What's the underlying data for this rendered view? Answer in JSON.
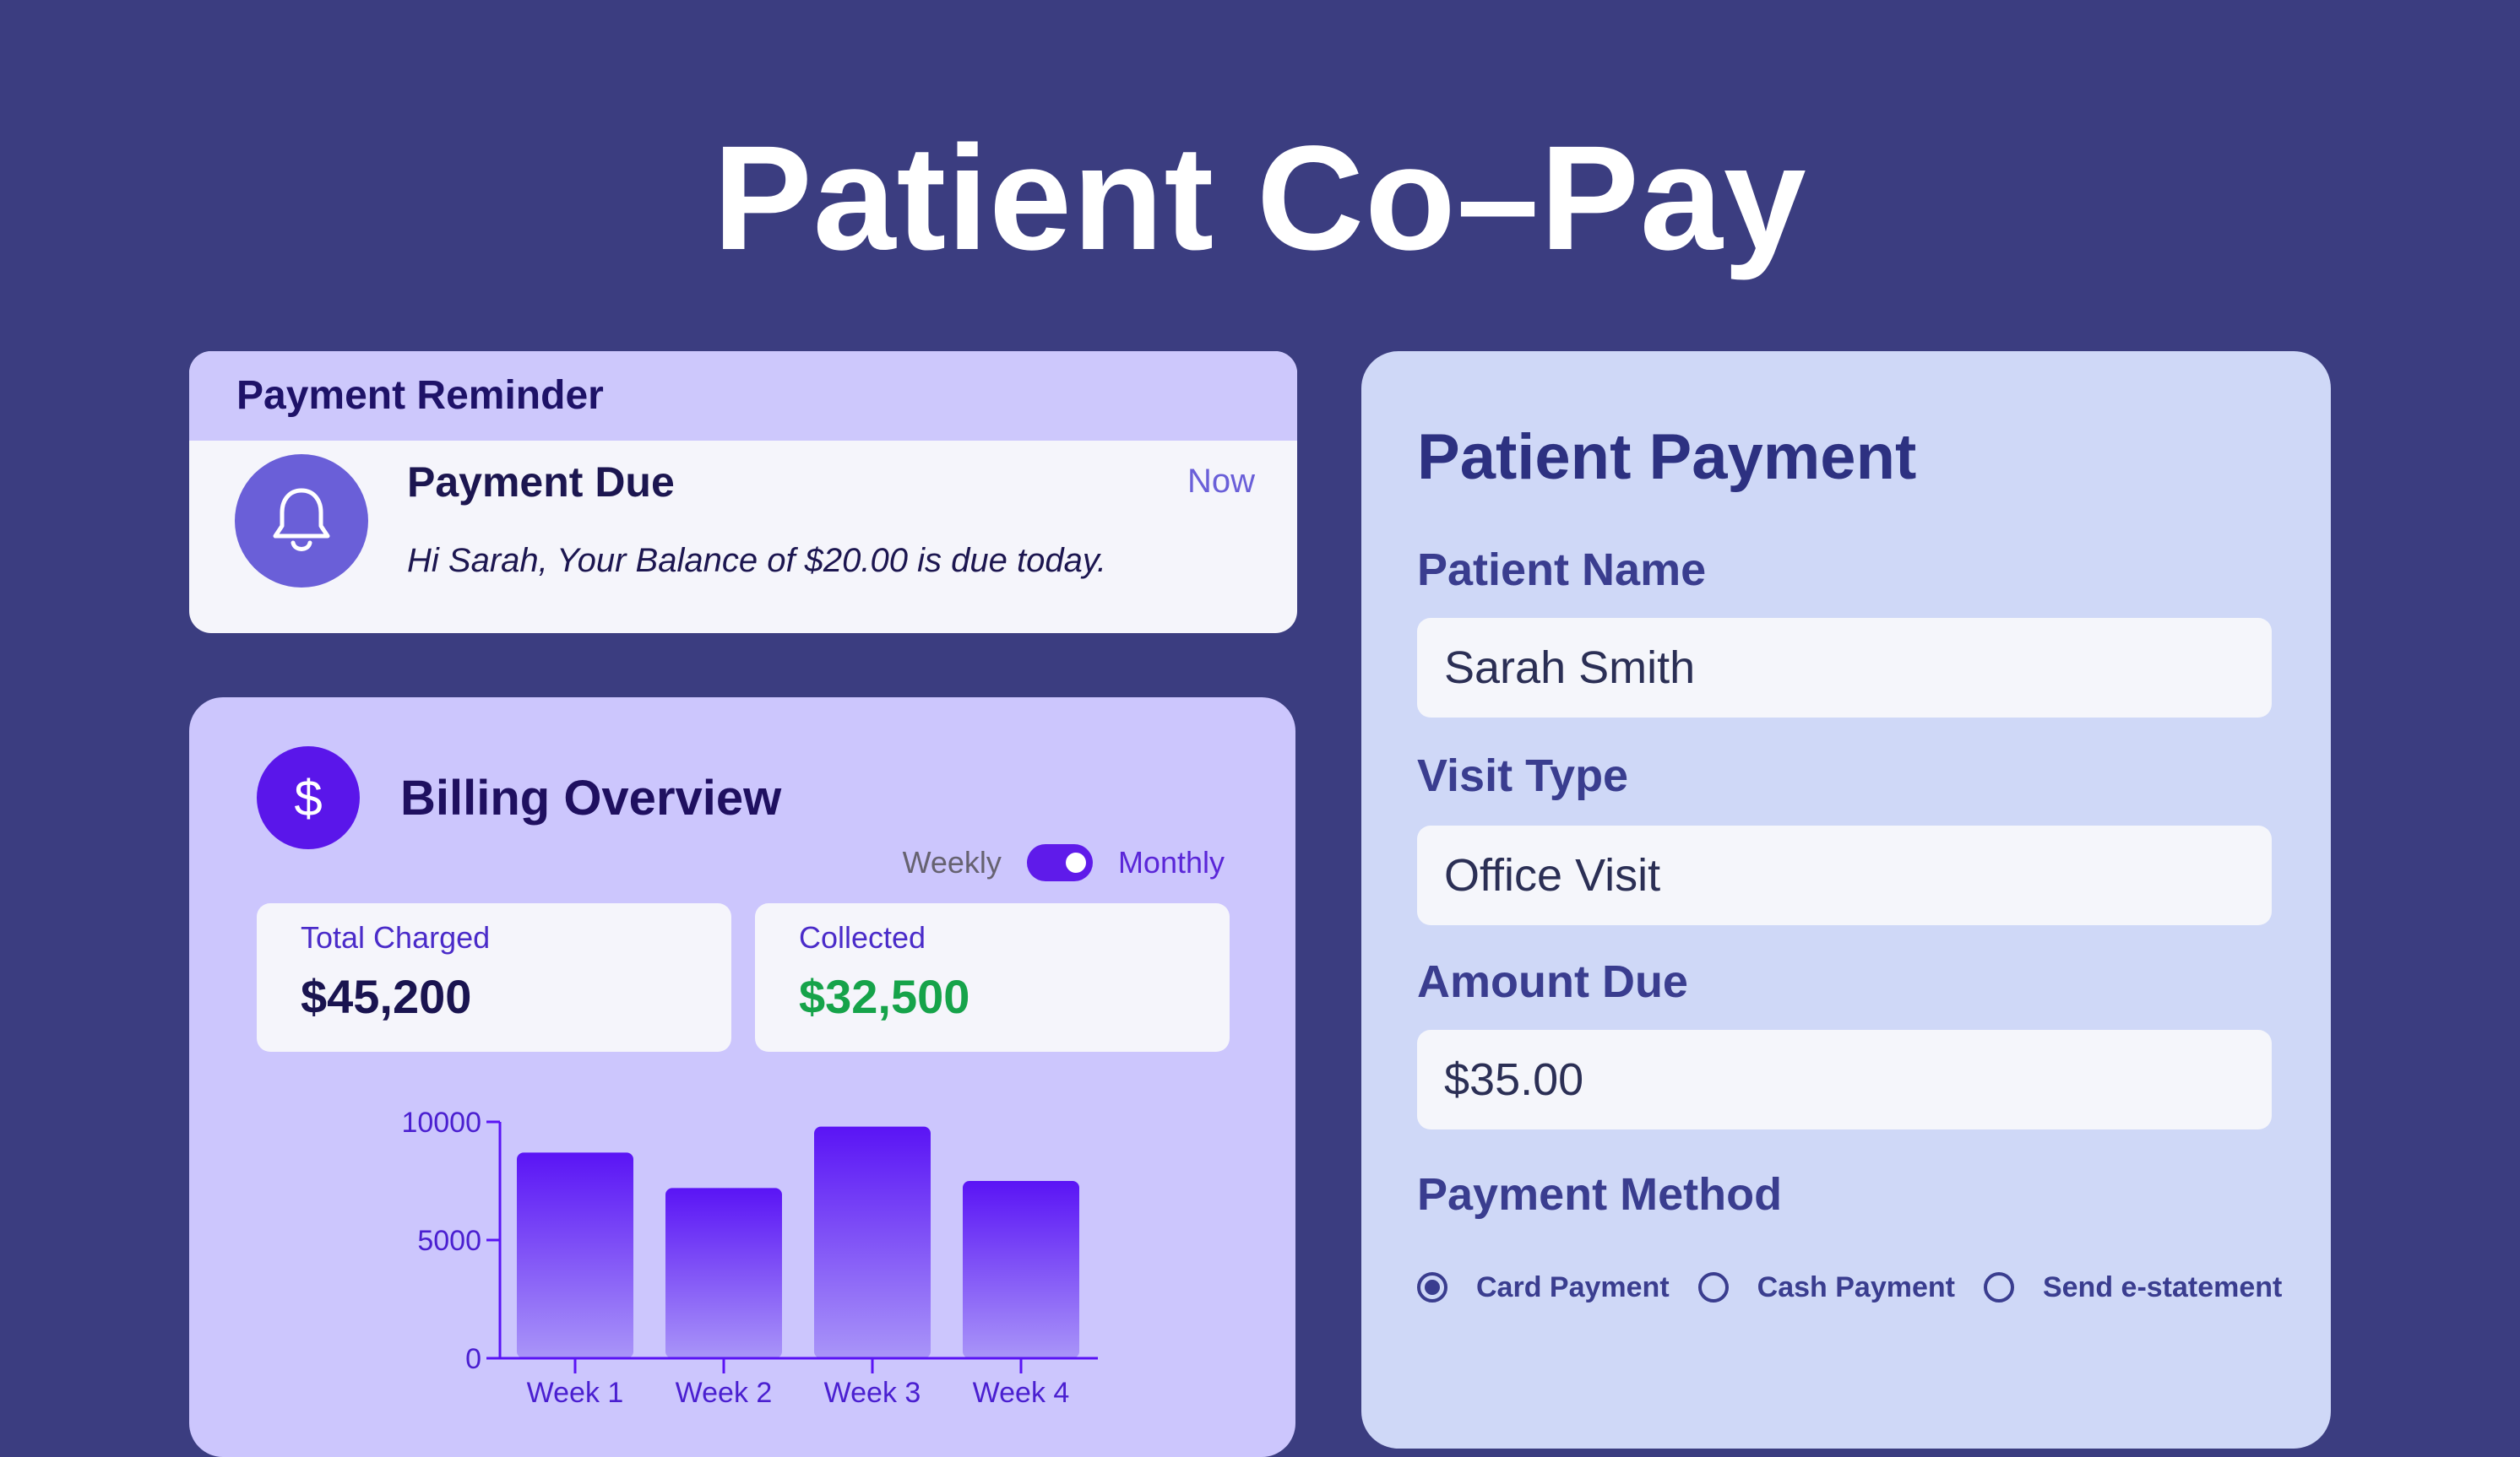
{
  "page": {
    "title": "Patient Co–Pay"
  },
  "reminder": {
    "header": "Payment Reminder",
    "icon": "bell-icon",
    "title": "Payment Due",
    "time": "Now",
    "message": "Hi Sarah, Your Balance of $20.00 is due today."
  },
  "billing": {
    "icon": "dollar-icon",
    "icon_glyph": "$",
    "title": "Billing Overview",
    "toggle": {
      "left_label": "Weekly",
      "right_label": "Monthly",
      "state": "Monthly"
    },
    "total_charged": {
      "label": "Total Charged",
      "value": "$45,200"
    },
    "collected": {
      "label": "Collected",
      "value": "$32,500"
    }
  },
  "chart_data": {
    "type": "bar",
    "categories": [
      "Week 1",
      "Week 2",
      "Week 3",
      "Week 4"
    ],
    "values": [
      8700,
      7200,
      9800,
      7500
    ],
    "ylim": [
      0,
      10000
    ],
    "yticks": [
      0,
      5000,
      10000
    ],
    "grid": false,
    "colors": {
      "bar_top": "#5a14f5",
      "bar_bottom": "#a995f8",
      "axis": "#5a14f5"
    }
  },
  "form": {
    "title": "Patient Payment",
    "patient_name": {
      "label": "Patient Name",
      "value": "Sarah Smith"
    },
    "visit_type": {
      "label": "Visit Type",
      "value": "Office Visit"
    },
    "amount_due": {
      "label": "Amount Due",
      "value": "$35.00"
    },
    "payment_method": {
      "label": "Payment Method",
      "options": [
        "Card Payment",
        "Cash Payment",
        "Send e-statement"
      ],
      "selected": "Card Payment"
    }
  }
}
